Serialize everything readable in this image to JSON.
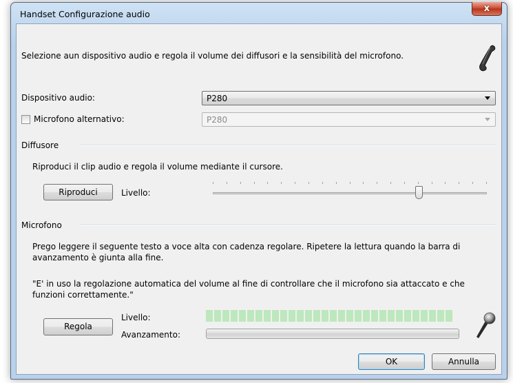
{
  "window": {
    "title": "Handset Configurazione audio",
    "close_glyph": "x"
  },
  "intro": {
    "text": "Selezione aun dispositivo audio e regola il volume dei diffusori e la sensibilità del microfono.",
    "icon": "handset-icon"
  },
  "device": {
    "label": "Dispositivo audio:",
    "value": "P280",
    "alt_mic_label": "Microfono alternativo:",
    "alt_mic_value": "P280",
    "alt_mic_checked": false
  },
  "speaker": {
    "group_label": "Diffusore",
    "instructions": "Riproduci il clip audio e regola il volume mediante il cursore.",
    "play_label": "Riproduci",
    "level_label": "Livello:",
    "volume_fraction": 0.76
  },
  "microphone": {
    "group_label": "Microfono",
    "instructions_line1": "Prego leggere il seguente testo a voce alta con cadenza regolare. Ripetere la lettura quando la barra di",
    "instructions_line2": "avanzamento è giunta alla fine.",
    "quote_line1": "\"E' in uso la regolazione automatica del volume al fine di controllare che il microfono sia attaccato e che",
    "quote_line2": "funzioni correttamente.\"",
    "adjust_label": "Regola",
    "level_label": "Livello:",
    "progress_label": "Avanzamento:",
    "level_fraction": 0,
    "progress_fraction": 0,
    "icon": "microphone-icon"
  },
  "footer": {
    "ok_label": "OK",
    "cancel_label": "Annulla"
  },
  "colors": {
    "level_segment": "#bde7bd",
    "title_bar": "#b9d1ea",
    "close": "#c7472f"
  }
}
